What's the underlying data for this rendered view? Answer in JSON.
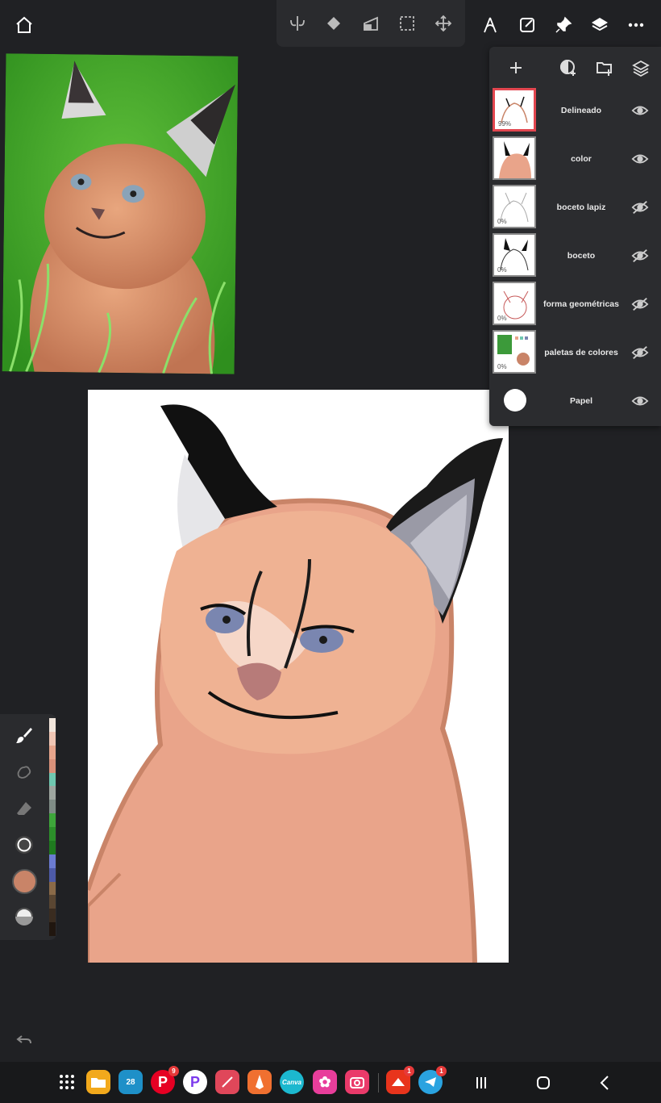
{
  "toolbar": {
    "left_icons": [
      "home-icon"
    ],
    "center_icons": [
      "symmetry-icon",
      "fill-icon",
      "perspective-icon",
      "selection-icon",
      "transform-icon"
    ],
    "right_icons": [
      "ruler-icon",
      "edit-icon",
      "pin-icon",
      "layers-icon",
      "more-icon"
    ]
  },
  "layers_panel": {
    "header_icons": [
      "add-layer-icon",
      "add-fill-layer-icon",
      "add-group-icon",
      "layer-blend-icon"
    ],
    "layers": [
      {
        "name": "Delineado",
        "opacity": "99%",
        "visible": true,
        "active": true
      },
      {
        "name": "color",
        "opacity": "",
        "visible": true,
        "active": false
      },
      {
        "name": "boceto lapiz",
        "opacity": "0%",
        "visible": false,
        "active": false
      },
      {
        "name": "boceto",
        "opacity": "0%",
        "visible": false,
        "active": false
      },
      {
        "name": "forma geométricas",
        "opacity": "0%",
        "visible": false,
        "active": false
      },
      {
        "name": "paletas de colores",
        "opacity": "0%",
        "visible": false,
        "active": false
      }
    ],
    "paper": {
      "name": "Papel",
      "visible": true
    }
  },
  "left_toolbar": {
    "tools": [
      "brush-icon",
      "smudge-icon",
      "eraser-icon",
      "brush-size-icon",
      "color-swatch-icon",
      "opacity-icon"
    ],
    "current_color": "#c98468",
    "palette": [
      "#f2e6dc",
      "#f0c6b4",
      "#e7a58c",
      "#d9917a",
      "#6fc7b0",
      "#9ea6a0",
      "#7f8c86",
      "#3ea63a",
      "#2c8f2a",
      "#1f7a1f",
      "#6b7bd1",
      "#4d5aa8",
      "#8a6a48",
      "#5a4632",
      "#3a2c20",
      "#20160f"
    ]
  },
  "bottom": {
    "undo_icon": "undo-icon"
  },
  "taskbar": {
    "apps": [
      {
        "name": "apps-icon",
        "label": ""
      },
      {
        "name": "files-app-icon",
        "label": ""
      },
      {
        "name": "calendar-app-icon",
        "label": "28"
      },
      {
        "name": "pinterest-app-icon",
        "label": "P",
        "badge": "9"
      },
      {
        "name": "picsart-app-icon",
        "label": "P"
      },
      {
        "name": "sketch-app-icon",
        "label": ""
      },
      {
        "name": "pencil-app-icon",
        "label": ""
      },
      {
        "name": "canva-app-icon",
        "label": "Canva"
      },
      {
        "name": "flower-app-icon",
        "label": "✿"
      },
      {
        "name": "camera-app-icon",
        "label": ""
      },
      {
        "name": "vpn-app-icon",
        "label": "",
        "badge": "1"
      },
      {
        "name": "telegram-app-icon",
        "label": "",
        "badge": "1"
      }
    ],
    "nav": [
      "recents-icon",
      "home-nav-icon",
      "back-icon"
    ]
  }
}
